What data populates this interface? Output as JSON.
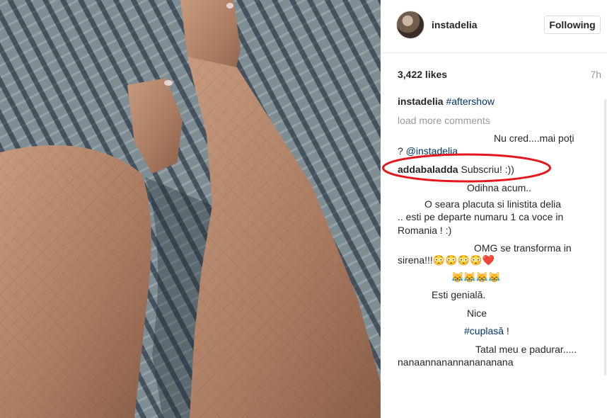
{
  "post": {
    "username": "instadelia",
    "follow_label": "Following",
    "likes": "3,422 likes",
    "time": "7h",
    "caption": {
      "user": "instadelia",
      "tag": "#aftershow"
    },
    "load_more": "load more comments"
  },
  "comments": {
    "c1_line1": "Nu cred....mai poți",
    "c1_prefix": "? ",
    "c1_mention": "@instadelia",
    "c2_user": "addabaladda",
    "c2_text": "Subscriu! :))",
    "c3": "Odihna acum..",
    "c4_line1": "O seara placuta si linistita delia",
    "c4_line2": ".. esti pe departe numaru 1 ca voce in",
    "c4_line3": "Romania ! :)",
    "c5_line1": "OMG se transforma in",
    "c5_line2": "sirena!!!😳😳😳😳❤️",
    "c6": "😹😹😹😹",
    "c7": "Esti genială.",
    "c8": "Nice",
    "c9_tag": "#cuplasă",
    "c9_after": " !",
    "c10_line1": "Tatal meu e padurar.....",
    "c10_line2": "nanaannanannanananana"
  },
  "annotation": {
    "color": "#e3171e",
    "shape": "ellipse"
  },
  "icons": [
    "avatar"
  ]
}
